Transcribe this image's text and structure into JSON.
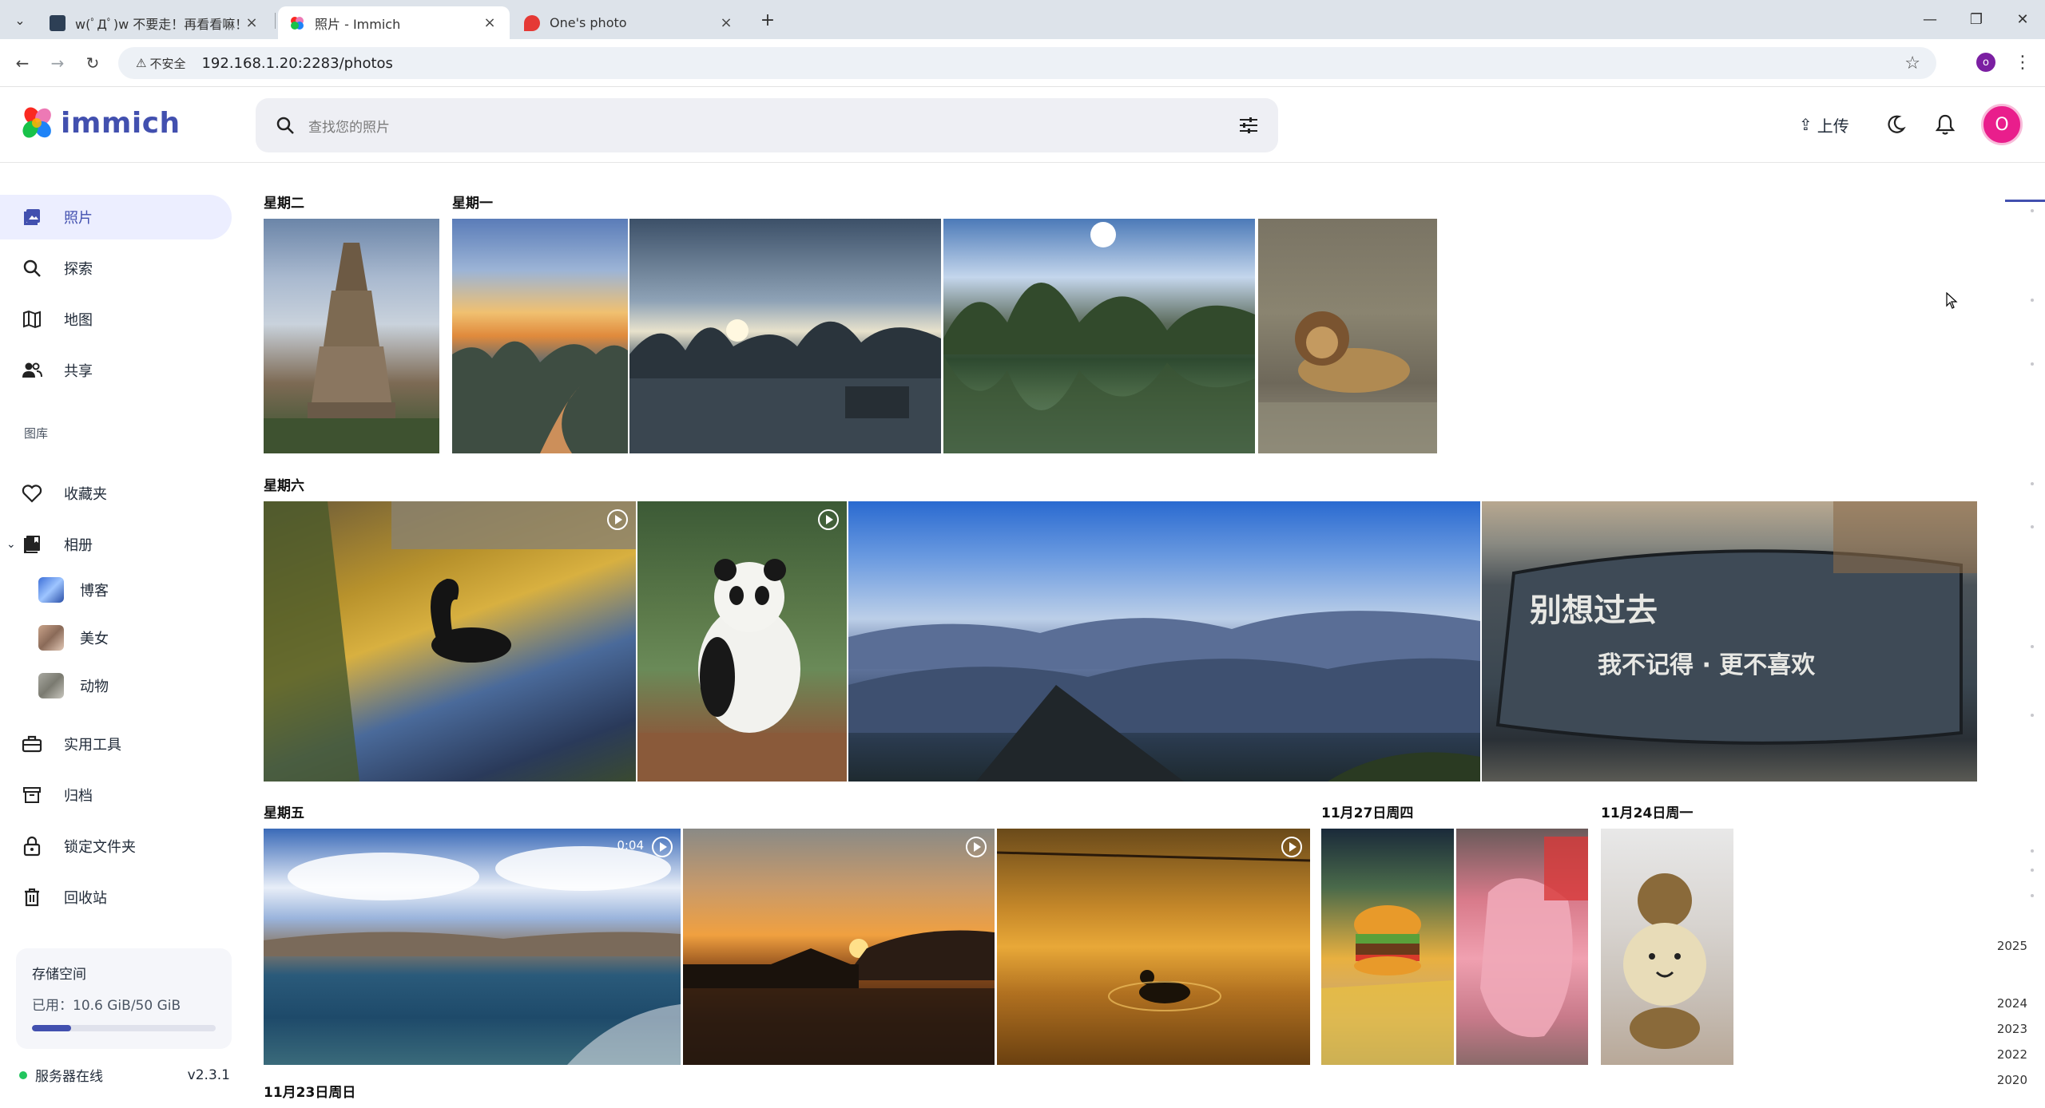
{
  "browser": {
    "tabs": [
      {
        "title": "w(ﾟДﾟ)w 不要走！再看看嘛！",
        "active": false
      },
      {
        "title": "照片 - Immich",
        "active": true
      },
      {
        "title": "One's photo",
        "active": false
      }
    ],
    "security_label": "不安全",
    "url": "192.168.1.20:2283/photos",
    "profile_initial": "o"
  },
  "app": {
    "logo_text": "immich",
    "search_placeholder": "查找您的照片",
    "upload_label": "上传",
    "avatar_initial": "O",
    "brand_color": "#4250af"
  },
  "sidebar": {
    "items": [
      {
        "label": "照片",
        "icon": "photos-icon",
        "active": true
      },
      {
        "label": "探索",
        "icon": "search-icon"
      },
      {
        "label": "地图",
        "icon": "map-icon"
      },
      {
        "label": "共享",
        "icon": "sharing-icon"
      }
    ],
    "library_heading": "图库",
    "favorites": "收藏夹",
    "albums": "相册",
    "album_list": [
      {
        "label": "博客"
      },
      {
        "label": "美女"
      },
      {
        "label": "动物"
      }
    ],
    "utilities": "实用工具",
    "archive": "归档",
    "locked_folder": "锁定文件夹",
    "trash": "回收站",
    "storage": {
      "title": "存储空间",
      "used": "已用：10.6 GiB/50 GiB",
      "fraction": 0.212
    },
    "server_status": "服务器在线",
    "version": "v2.3.1"
  },
  "timeline": {
    "groups": [
      {
        "label": "星期二"
      },
      {
        "label": "星期一"
      },
      {
        "label": "星期六"
      },
      {
        "label": "星期五"
      },
      {
        "label": "11月27日周四"
      },
      {
        "label": "11月24日周一"
      },
      {
        "label": "11月23日周日"
      }
    ],
    "video_duration": "0:04"
  },
  "scrubber": {
    "years": [
      "2025",
      "2024",
      "2023",
      "2022",
      "2020"
    ]
  }
}
